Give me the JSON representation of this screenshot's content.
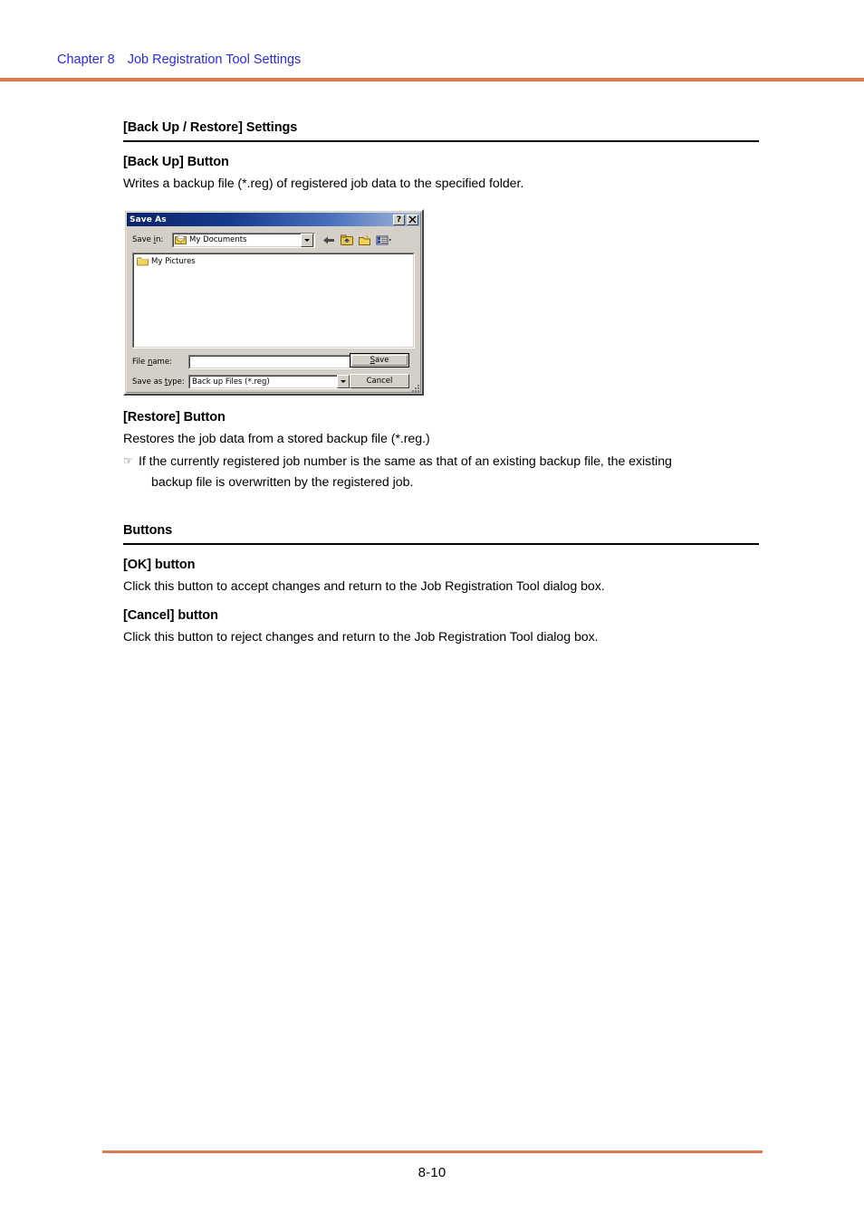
{
  "header": {
    "chapter": "Chapter 8",
    "title": "Job Registration Tool Settings",
    "rule_color": "#e0784e",
    "text_color": "#2b2bd6"
  },
  "sections": [
    {
      "heading": "[Back Up / Restore] Settings",
      "blocks": [
        {
          "subheading": "[Back Up] Button",
          "paragraph": "Writes a backup file (*.reg) of registered job data to the specified folder."
        },
        {
          "subheading": "[Restore] Button",
          "paragraph": "Restores the job data from a stored backup file (*.reg.)",
          "note_glyph": "☞",
          "note_line1": "If the currently registered job number is the same as that of an existing backup file, the existing",
          "note_line2": "backup file is overwritten by the registered job."
        }
      ]
    },
    {
      "heading": "Buttons",
      "blocks": [
        {
          "subheading": "[OK] button",
          "paragraph": "Click this button to accept changes and return to the Job Registration Tool dialog box."
        },
        {
          "subheading": "[Cancel] button",
          "paragraph": "Click this button to reject changes and return to the Job Registration Tool dialog box."
        }
      ]
    }
  ],
  "figure": {
    "dialog": {
      "title": "Save As",
      "titlebar_gradient_start": "#0a246a",
      "titlebar_gradient_end": "#a6badc",
      "help_button": "?",
      "close_button": "✕",
      "save_in": {
        "label_pre": "Save ",
        "label_accel": "i",
        "label_post": "n:",
        "value": "My Documents",
        "icon": "my-documents-icon"
      },
      "toolbar_icons": [
        "back-arrow-icon",
        "up-one-level-icon",
        "create-new-folder-icon",
        "views-icon"
      ],
      "file_list": [
        {
          "name": "My Pictures",
          "icon": "folder-icon"
        }
      ],
      "file_name": {
        "label_pre": "File ",
        "label_accel": "n",
        "label_post": "ame:",
        "value": ""
      },
      "save_as_type": {
        "label_pre": "Save as ",
        "label_accel": "t",
        "label_post": "ype:",
        "value": "Back up Files (*.reg)"
      },
      "buttons": {
        "save_pre": "",
        "save_accel": "S",
        "save_post": "ave",
        "cancel": "Cancel"
      }
    }
  },
  "footer": {
    "page_number": "8-10",
    "rule_color": "#e0784e"
  }
}
